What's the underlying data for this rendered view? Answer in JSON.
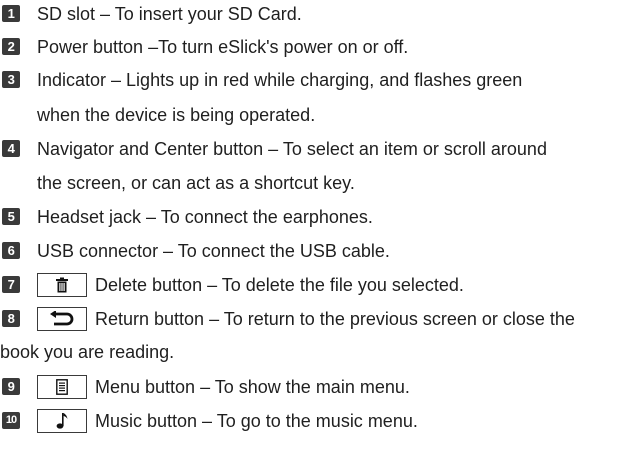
{
  "items": [
    {
      "number": "1",
      "text": "SD slot – To insert your SD Card."
    },
    {
      "number": "2",
      "text": "Power button –To turn eSlick's power on or off."
    },
    {
      "number": "3",
      "text": "Indicator – Lights up in red while charging, and flashes green",
      "continuation": "when the device is being operated."
    },
    {
      "number": "4",
      "text": "Navigator and Center button – To select an item or scroll around",
      "continuation": "the screen, or can act as a shortcut key."
    },
    {
      "number": "5",
      "text": "Headset jack – To connect the earphones."
    },
    {
      "number": "6",
      "text": "USB connector – To connect the USB cable."
    },
    {
      "number": "7",
      "icon": "trash-icon",
      "text": "Delete button – To delete the file you selected."
    },
    {
      "number": "8",
      "icon": "return-arrow-icon",
      "text": "Return button – To return to the previous screen or close the",
      "continuation": "book you are reading."
    },
    {
      "number": "9",
      "icon": "menu-list-icon",
      "text": "Menu button – To show the main menu."
    },
    {
      "number": "10",
      "icon": "music-note-icon",
      "text": "Music button – To go to the music menu."
    }
  ]
}
